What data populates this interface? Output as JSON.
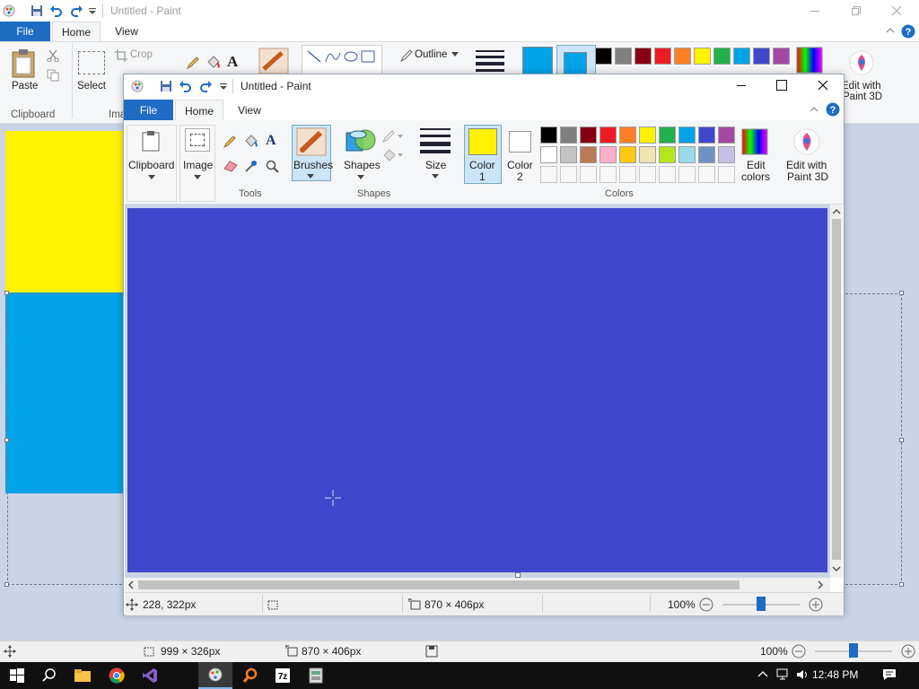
{
  "bg_window": {
    "title": "Untitled - Paint",
    "tabs": {
      "file": "File",
      "home": "Home",
      "view": "View"
    },
    "ribbon": {
      "paste": "Paste",
      "clipboard": "Clipboard",
      "select": "Select",
      "crop": "Crop",
      "image_partial": "Ima",
      "outline": "Outline",
      "edit_with_3d_line1": "Edit with",
      "edit_with_3d_line2": "Paint 3D"
    },
    "status": {
      "selection_size": "999 × 326px",
      "image_size": "870 × 406px",
      "zoom": "100%"
    }
  },
  "fg_window": {
    "title": "Untitled - Paint",
    "tabs": {
      "file": "File",
      "home": "Home",
      "view": "View"
    },
    "ribbon": {
      "clipboard": "Clipboard",
      "image": "Image",
      "tools": "Tools",
      "brushes": "Brushes",
      "shapes": "Shapes",
      "shapes_group": "Shapes",
      "size": "Size",
      "color1_line1": "Color",
      "color1_line2": "1",
      "color2_line1": "Color",
      "color2_line2": "2",
      "edit_colors_line1": "Edit",
      "edit_colors_line2": "colors",
      "edit_3d_line1": "Edit with",
      "edit_3d_line2": "Paint 3D",
      "colors_group": "Colors"
    },
    "status": {
      "cursor_pos": "228, 322px",
      "image_size": "870 × 406px",
      "zoom": "100%"
    },
    "color1": "#fff200",
    "color2": "#ffffff",
    "canvas_color": "#3f48cc"
  },
  "palette_row1": [
    "#000000",
    "#7f7f7f",
    "#880015",
    "#ed1c24",
    "#ff7f27",
    "#fff200",
    "#22b14c",
    "#00a2e8",
    "#3f48cc",
    "#a349a4"
  ],
  "palette_row2": [
    "#ffffff",
    "#c3c3c3",
    "#b97a57",
    "#ffaec9",
    "#ffc90e",
    "#efe4b0",
    "#b5e61d",
    "#99d9ea",
    "#7092be",
    "#c8bfe7"
  ],
  "bg_palette_row1": [
    "#000000",
    "#7f7f7f",
    "#880015",
    "#ed1c24",
    "#ff7f27",
    "#fff200",
    "#22b14c",
    "#00a2e8",
    "#3f48cc",
    "#a349a4"
  ],
  "taskbar": {
    "clock": "12:48 PM"
  }
}
